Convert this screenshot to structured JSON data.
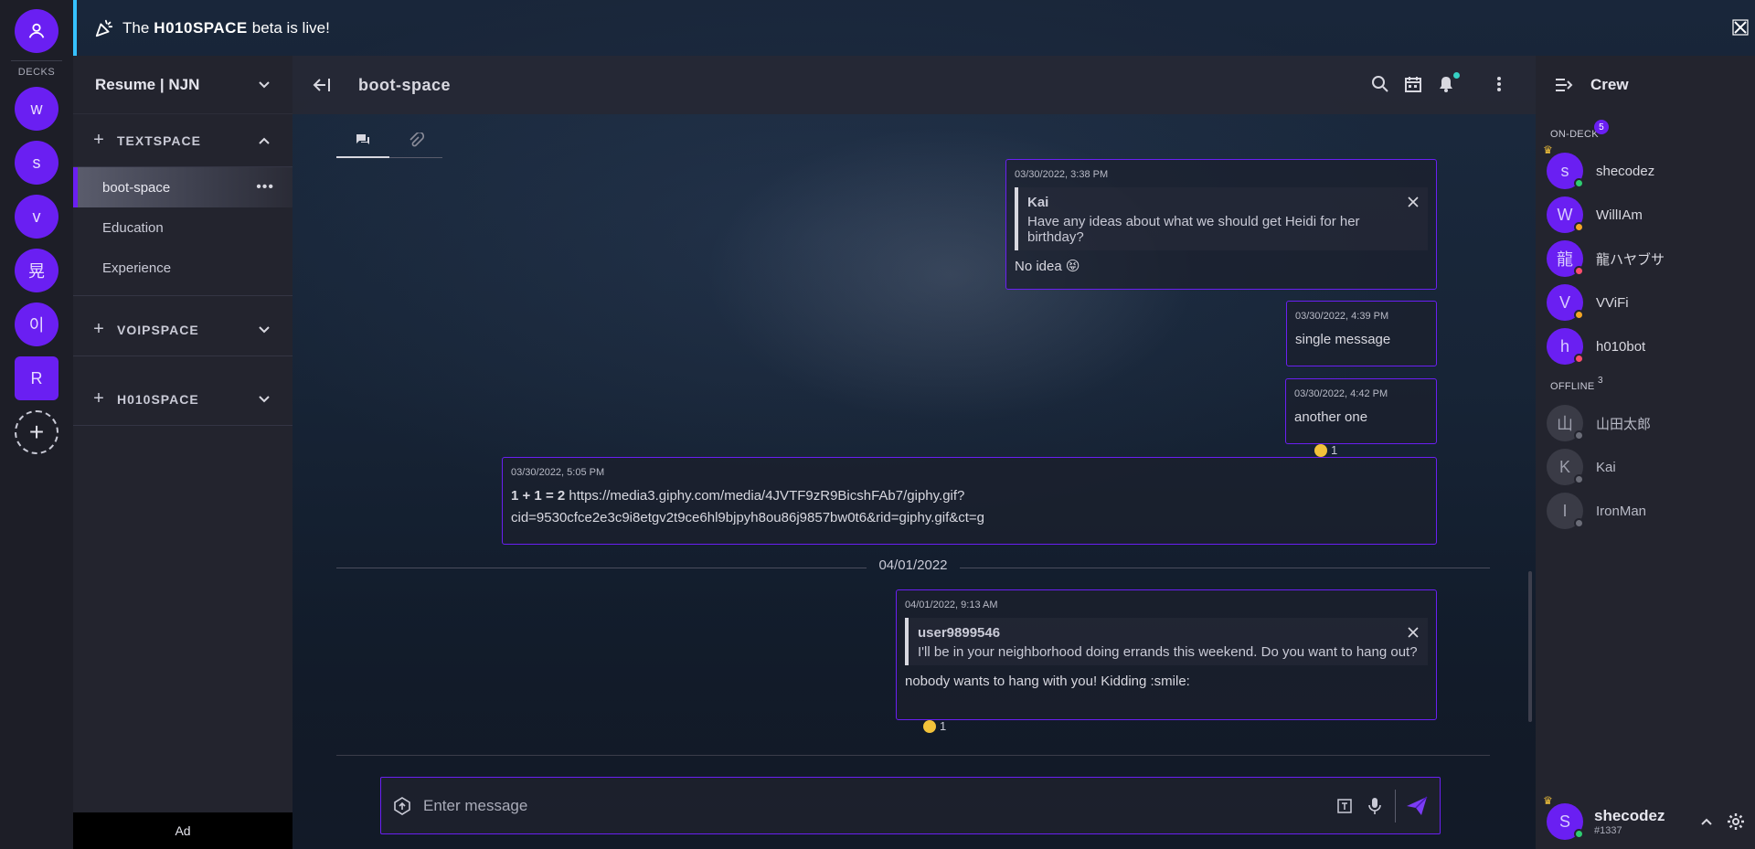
{
  "rail": {
    "decks_label": "DECKS",
    "servers": [
      "w",
      "s",
      "v",
      "晃",
      "이",
      "R"
    ]
  },
  "banner": {
    "prefix": "The",
    "brand": "H010SPACE",
    "suffix": "beta is live!"
  },
  "workspace": {
    "title": "Resume | NJN"
  },
  "categories": [
    {
      "name": "TEXTSPACE",
      "expanded": true,
      "channels": [
        "boot-space",
        "Education",
        "Experience"
      ]
    },
    {
      "name": "VOIPSPACE",
      "expanded": false
    },
    {
      "name": "H010SPACE",
      "expanded": false
    }
  ],
  "ad_label": "Ad",
  "channel": {
    "title": "boot-space"
  },
  "messages": [
    {
      "time": "03/30/2022, 3:38 PM",
      "reply_name": "Kai",
      "reply_text": "Have any ideas about what we should get Heidi for her birthday?",
      "text": "No idea 😝"
    },
    {
      "time": "03/30/2022, 4:39 PM",
      "text": "single message"
    },
    {
      "time": "03/30/2022, 4:42 PM",
      "text": "another one",
      "reaction_count": "1"
    },
    {
      "time": "03/30/2022, 5:05 PM",
      "bold": "1 + 1 = 2",
      "text": "https://media3.giphy.com/media/4JVTF9zR9BicshFAb7/giphy.gif?",
      "text2": "cid=9530cfce2e3c9i8etgv2t9ce6hl9bjpyh8ou86j9857bw0t6&rid=giphy.gif&ct=g"
    },
    {
      "time": "04/01/2022, 9:13 AM",
      "reply_name": "user9899546",
      "reply_text": "I'll be in your neighborhood doing errands this weekend. Do you want to hang out?",
      "text": "nobody wants to hang with you! Kidding :smile:",
      "reaction_count": "1"
    }
  ],
  "date_separator": "04/01/2022",
  "composer": {
    "placeholder": "Enter message"
  },
  "crew": {
    "title": "Crew",
    "on_deck_label": "ON-DECK",
    "on_deck_count": "5",
    "offline_label": "OFFLINE",
    "offline_count": "3",
    "online": [
      {
        "initial": "s",
        "name": "shecodez",
        "status_color": "#2ecc71"
      },
      {
        "initial": "W",
        "name": "WillIAm",
        "status_color": "#f5a623"
      },
      {
        "initial": "龍",
        "name": "龍ハヤブサ",
        "status_color": "#ff4d6d"
      },
      {
        "initial": "V",
        "name": "VViFi",
        "status_color": "#f5a623"
      },
      {
        "initial": "h",
        "name": "h010bot",
        "status_color": "#ff4d6d"
      }
    ],
    "offline": [
      {
        "initial": "山",
        "name": "山田太郎"
      },
      {
        "initial": "K",
        "name": "Kai"
      },
      {
        "initial": "I",
        "name": "IronMan"
      }
    ]
  },
  "me": {
    "initial": "S",
    "username": "shecodez",
    "tag": "#1337"
  },
  "colors": {
    "accent": "#6a1ff2",
    "banner_accent": "#36c1ff"
  }
}
